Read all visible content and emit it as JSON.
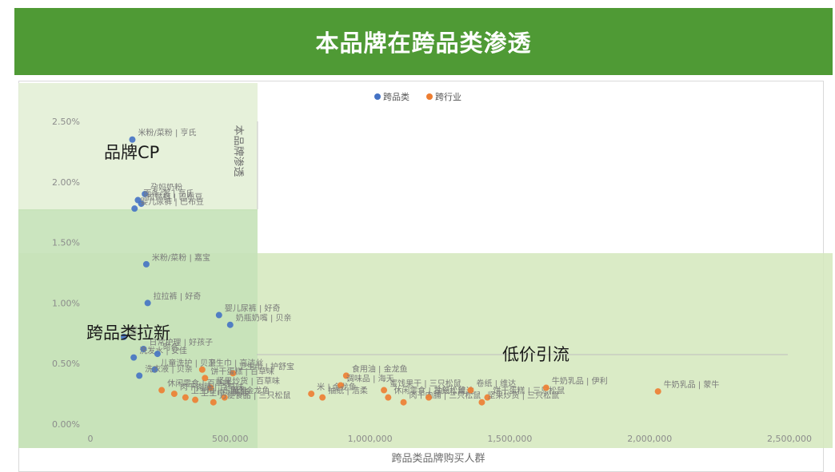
{
  "banner": {
    "title": "本品牌在跨品类渗透"
  },
  "colors": {
    "banner": "#4f9a35",
    "cross_category": "#4472c4",
    "cross_industry": "#ed7d31",
    "zone_brand_cp": "#e2efd4",
    "zone_cross_category": "#c5e2b8",
    "zone_low_price": "#d4e8bc"
  },
  "zones": [
    {
      "label": "品牌CP"
    },
    {
      "label": "跨品类拉新"
    },
    {
      "label": "低价引流"
    }
  ],
  "chart_data": {
    "type": "scatter",
    "xlabel": "跨品类品牌购买人群",
    "ylabel": "本品牌渗透",
    "xlim": [
      0,
      2500000
    ],
    "ylim": [
      0,
      0.025
    ],
    "x_ticks": [
      "0",
      "500,000",
      "1,000,000",
      "1,500,000",
      "2,000,000",
      "2,500,000"
    ],
    "y_ticks": [
      "0.00%",
      "0.50%",
      "1.00%",
      "1.50%",
      "2.00%",
      "2.50%"
    ],
    "legend": "top",
    "series": [
      {
        "name": "跨品类",
        "points": [
          {
            "label": "米粉/菜粉 | 亨氏",
            "x": 150000,
            "y": 0.0235
          },
          {
            "label": "孕妈奶粉",
            "x": 195000,
            "y": 0.019
          },
          {
            "label": "面条/粥 | 亨氏",
            "x": 170000,
            "y": 0.0185
          },
          {
            "label": "拉拉裤 | 巴布豆",
            "x": 182000,
            "y": 0.0182
          },
          {
            "label": "婴儿尿裤 | 巴布豆",
            "x": 158000,
            "y": 0.0178
          },
          {
            "label": "米粉/菜粉 | 嘉宝",
            "x": 200000,
            "y": 0.0132
          },
          {
            "label": "拉拉裤 | 好奇",
            "x": 205000,
            "y": 0.01
          },
          {
            "label": "婴儿尿裤 | 好奇",
            "x": 460000,
            "y": 0.009
          },
          {
            "label": "奶瓶奶嘴 | 贝亲",
            "x": 500000,
            "y": 0.0082
          },
          {
            "label": "宝",
            "x": 120000,
            "y": 0.0072
          },
          {
            "label": "日常护理 | 好孩子",
            "x": 190000,
            "y": 0.0062
          },
          {
            "label": "洗发水 | 安佳",
            "x": 155000,
            "y": 0.0055
          },
          {
            "label": "时代",
            "x": 240000,
            "y": 0.0058
          },
          {
            "label": "儿童洗护 | 贝亲",
            "x": 230000,
            "y": 0.0045
          },
          {
            "label": "洗衣液 | 贝亲",
            "x": 175000,
            "y": 0.004
          }
        ]
      },
      {
        "name": "跨行业",
        "points": [
          {
            "label": "卫生巾 | 高洁丝",
            "x": 400000,
            "y": 0.0045
          },
          {
            "label": "卫生巾 | 护舒宝",
            "x": 510000,
            "y": 0.0042
          },
          {
            "label": "饼干蛋糕 | 百草味",
            "x": 410000,
            "y": 0.0038
          },
          {
            "label": "坚果炒货 | 百草味",
            "x": 430000,
            "y": 0.003
          },
          {
            "label": "休闲零食 | 百草味",
            "x": 255000,
            "y": 0.0028
          },
          {
            "label": "肉干肉脯 | 百草味",
            "x": 300000,
            "y": 0.0025
          },
          {
            "label": "卫生巾 | 乐而雅",
            "x": 340000,
            "y": 0.0022
          },
          {
            "label": "卫生巾 | 苏菲",
            "x": 375000,
            "y": 0.002
          },
          {
            "label": "面 | 金龙鱼",
            "x": 480000,
            "y": 0.0022
          },
          {
            "label": "方便食品 | 三只松鼠",
            "x": 440000,
            "y": 0.0018
          },
          {
            "label": "米 | 金龙鱼",
            "x": 790000,
            "y": 0.0025
          },
          {
            "label": "食用油 | 金龙鱼",
            "x": 915000,
            "y": 0.004
          },
          {
            "label": "调味品 | 海天",
            "x": 895000,
            "y": 0.0032
          },
          {
            "label": "抽纸 | 洁柔",
            "x": 830000,
            "y": 0.0022
          },
          {
            "label": "蜜饯果干 | 三只松鼠",
            "x": 1050000,
            "y": 0.0028
          },
          {
            "label": "休闲零食 | 三只松鼠",
            "x": 1065000,
            "y": 0.0022
          },
          {
            "label": "肉干肉脯 | 三只松鼠",
            "x": 1120000,
            "y": 0.0018
          },
          {
            "label": "抽纸 | 维达",
            "x": 1210000,
            "y": 0.0022
          },
          {
            "label": "卷纸 | 维达",
            "x": 1360000,
            "y": 0.0028
          },
          {
            "label": "饼干蛋糕 | 三只松鼠",
            "x": 1420000,
            "y": 0.0022
          },
          {
            "label": "坚果炒货 | 三只松鼠",
            "x": 1400000,
            "y": 0.0018
          },
          {
            "label": "牛奶乳品 | 伊利",
            "x": 1630000,
            "y": 0.003
          },
          {
            "label": "牛奶乳品 | 蒙牛",
            "x": 2030000,
            "y": 0.0027
          }
        ]
      }
    ]
  }
}
